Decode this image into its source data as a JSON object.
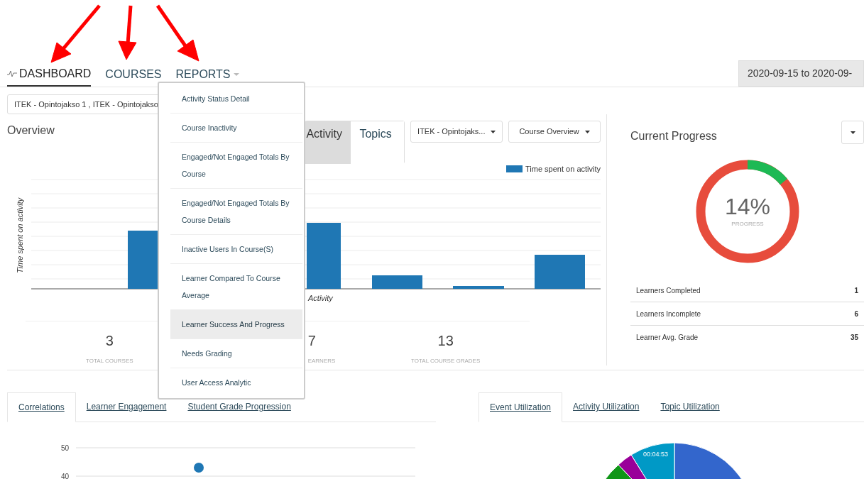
{
  "nav": {
    "tabs": [
      {
        "label": "DASHBOARD",
        "selected": true,
        "kind": "pulse"
      },
      {
        "label": "COURSES",
        "selected": false,
        "kind": "plain"
      },
      {
        "label": "REPORTS",
        "selected": false,
        "kind": "menu"
      }
    ],
    "date_range": "2020-09-15 to 2020-09-"
  },
  "course_filter": "ITEK - Opintojakso 1 , ITEK - Opintojakso",
  "reports_menu": [
    {
      "label": "Activity Status Detail",
      "selected": false
    },
    {
      "label": "Course Inactivity",
      "selected": false
    },
    {
      "label": "Engaged/Not Engaged Totals By Course",
      "selected": false
    },
    {
      "label": "Engaged/Not Engaged Totals By Course Details",
      "selected": false
    },
    {
      "label": "Inactive Users In Course(S)",
      "selected": false
    },
    {
      "label": "Learner Compared To Course Average",
      "selected": false
    },
    {
      "label": "Learner Success And Progress",
      "selected": true
    },
    {
      "label": "Needs Grading",
      "selected": false
    },
    {
      "label": "User Access Analytic",
      "selected": false
    }
  ],
  "overview": {
    "title": "Overview",
    "tabs": [
      {
        "label": "Activity",
        "selected": true
      },
      {
        "label": "Topics",
        "selected": false
      }
    ],
    "selects": [
      "ITEK - Opintojaks...",
      "Course Overview"
    ],
    "legend": "Time spent on activity",
    "y_axis_title": "Time spent on activity",
    "x_axis_title": "Activity",
    "stats": [
      {
        "value": "3",
        "label": "TOTAL COURSES",
        "kind": "full"
      },
      {
        "value": "7",
        "label": "EARNERS",
        "kind": "clipped"
      },
      {
        "value": "13",
        "label": "TOTAL COURSE GRADES",
        "kind": "full"
      }
    ]
  },
  "current_progress": {
    "title": "Current Progress",
    "level": 0.14,
    "percent": "14%",
    "caption": "PROGRESS",
    "rows": [
      {
        "label": "Learners Completed",
        "value": "1"
      },
      {
        "label": "Learners Incomplete",
        "value": "6"
      },
      {
        "label": "Learner Avg. Grade",
        "value": "35"
      }
    ]
  },
  "correlations": {
    "tabs": [
      {
        "label": "Correlations",
        "selected": true
      },
      {
        "label": "Learner Engagement",
        "selected": false
      },
      {
        "label": "Student Grade Progression",
        "selected": false
      }
    ],
    "chart_data": {
      "type": "scatter",
      "ylim": [
        40,
        50
      ],
      "yticks": [
        40,
        50
      ],
      "series": [
        {
          "color": "#1f77b4",
          "values": [
            43
          ]
        }
      ]
    }
  },
  "utilization": {
    "tabs": [
      {
        "label": "Event Utilization",
        "selected": true
      },
      {
        "label": "Activity Utilization",
        "selected": false
      },
      {
        "label": "Topic Utilization",
        "selected": false
      }
    ],
    "pie_label": "00:04:53"
  }
}
